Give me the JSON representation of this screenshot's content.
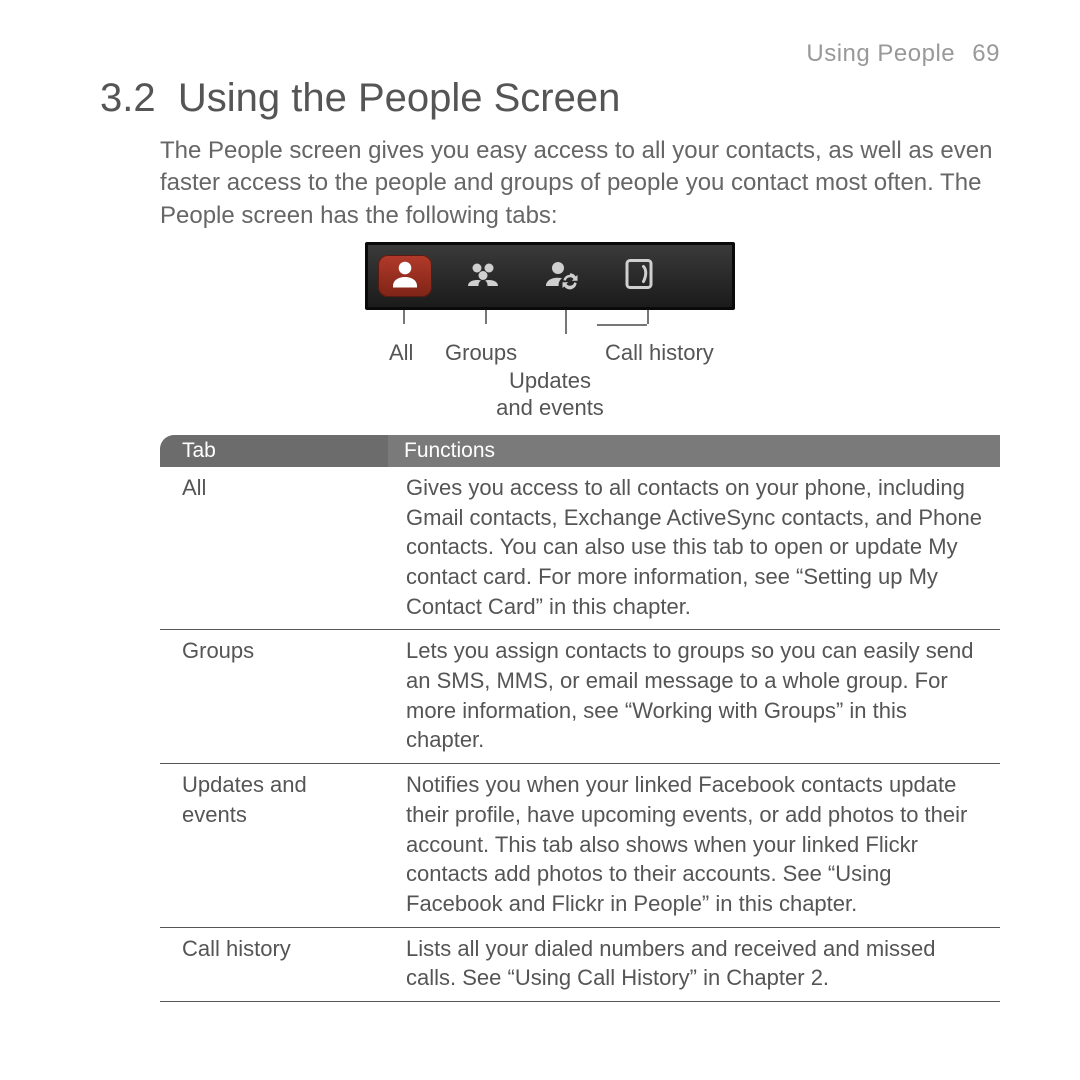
{
  "header": {
    "chapter": "Using People",
    "page": "69"
  },
  "section": {
    "number": "3.2",
    "title": "Using the People Screen"
  },
  "intro": "The People screen gives you easy access to all your contacts, as well as even faster access to the people and groups of people you contact most often. The People screen has the following tabs:",
  "tabbar": {
    "labels": {
      "all": "All",
      "groups": "Groups",
      "updates": "Updates\nand events",
      "callhistory": "Call history"
    },
    "updates_line1": "Updates",
    "updates_line2": "and events"
  },
  "table": {
    "head": {
      "tab": "Tab",
      "functions": "Functions"
    },
    "rows": [
      {
        "tab": "All",
        "func": "Gives you access to all contacts on your phone, including Gmail contacts, Exchange ActiveSync contacts, and Phone contacts. You can also use this tab to open or update My contact card. For more information, see “Setting up My Contact Card” in this chapter."
      },
      {
        "tab": "Groups",
        "func": "Lets you assign contacts to groups so you can easily send an SMS, MMS, or email message to a whole group. For more information, see “Working with Groups” in this chapter."
      },
      {
        "tab": "Updates and events",
        "func": "Notifies you when your linked Facebook contacts update their profile, have upcoming events, or add photos to their account. This tab also shows when your linked Flickr contacts add photos to their accounts. See “Using Facebook and Flickr in People” in this chapter."
      },
      {
        "tab": "Call history",
        "func": "Lists all your dialed numbers and received and missed calls. See “Using Call History” in Chapter 2."
      }
    ]
  }
}
